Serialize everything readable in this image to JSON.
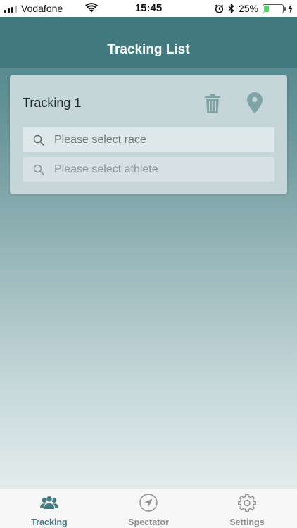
{
  "status_bar": {
    "carrier": "Vodafone",
    "time": "15:45",
    "battery_percent": "25%",
    "battery_level": 0.25
  },
  "header": {
    "title": "Tracking List"
  },
  "tracking_card": {
    "title": "Tracking 1",
    "race_field": {
      "placeholder": "Please select race",
      "value": ""
    },
    "athlete_field": {
      "placeholder": "Please select athlete",
      "value": ""
    }
  },
  "tab_bar": {
    "tabs": [
      {
        "label": "Tracking",
        "icon": "group-icon",
        "active": true
      },
      {
        "label": "Spectator",
        "icon": "navigation-arrow-icon",
        "active": false
      },
      {
        "label": "Settings",
        "icon": "gear-icon",
        "active": false
      }
    ]
  },
  "colors": {
    "primary": "#447c82",
    "card_background": "#c6d6d8",
    "icon_tint": "#7fa3a6",
    "inactive_tab": "#8e8e8e"
  }
}
